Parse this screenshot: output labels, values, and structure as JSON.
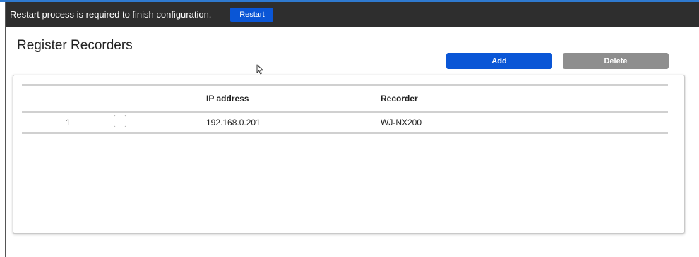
{
  "notice": {
    "message": "Restart process is required to finish configuration.",
    "restart_label": "Restart"
  },
  "page": {
    "title": "Register Recorders"
  },
  "actions": {
    "add_label": "Add",
    "delete_label": "Delete"
  },
  "table": {
    "columns": [
      "",
      "",
      "IP address",
      "Recorder"
    ],
    "rows": [
      {
        "index": "1",
        "checked": false,
        "ip_address": "192.168.0.201",
        "recorder": "WJ-NX200"
      }
    ]
  },
  "colors": {
    "notice_bar": "#2e2e2e",
    "primary": "#0a56d6",
    "disabled": "#8e8e8e"
  }
}
